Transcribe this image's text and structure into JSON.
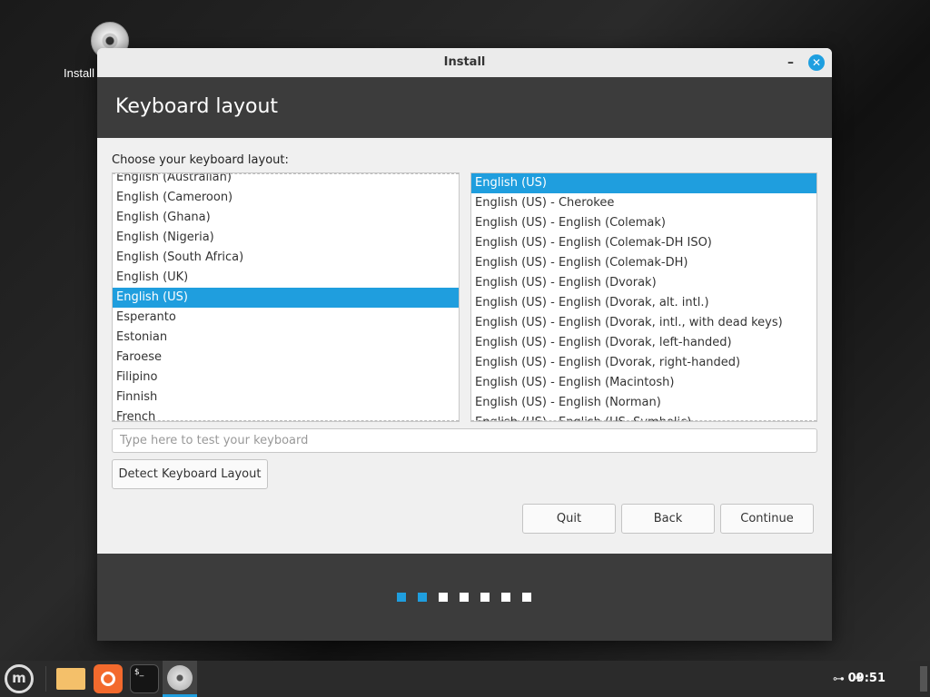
{
  "desktop": {
    "install_icon_label": "Install"
  },
  "window": {
    "title": "Install",
    "minimize": "–",
    "close": "✕"
  },
  "header": {
    "title": "Keyboard layout"
  },
  "content": {
    "choose_label": "Choose your keyboard layout:",
    "languages": [
      "English (Australian)",
      "English (Cameroon)",
      "English (Ghana)",
      "English (Nigeria)",
      "English (South Africa)",
      "English (UK)",
      "English (US)",
      "Esperanto",
      "Estonian",
      "Faroese",
      "Filipino",
      "Finnish",
      "French"
    ],
    "selected_language": "English (US)",
    "variants": [
      "English (US)",
      "English (US) - Cherokee",
      "English (US) - English (Colemak)",
      "English (US) - English (Colemak-DH ISO)",
      "English (US) - English (Colemak-DH)",
      "English (US) - English (Dvorak)",
      "English (US) - English (Dvorak, alt. intl.)",
      "English (US) - English (Dvorak, intl., with dead keys)",
      "English (US) - English (Dvorak, left-handed)",
      "English (US) - English (Dvorak, right-handed)",
      "English (US) - English (Macintosh)",
      "English (US) - English (Norman)",
      "English (US) - English (US, Symbolic)"
    ],
    "selected_variant": "English (US)",
    "test_placeholder": "Type here to test your keyboard",
    "test_value": "",
    "detect_label": "Detect Keyboard Layout",
    "quit_label": "Quit",
    "back_label": "Back",
    "continue_label": "Continue"
  },
  "progress": {
    "total_steps": 7,
    "current_step": 2
  },
  "colors": {
    "accent": "#1f9ede"
  },
  "taskbar": {
    "apps": [
      "menu-icon",
      "files-icon",
      "firefox-icon",
      "terminal-icon",
      "installer-icon"
    ],
    "terminal_glyph": "$_",
    "clock": "09:51"
  }
}
